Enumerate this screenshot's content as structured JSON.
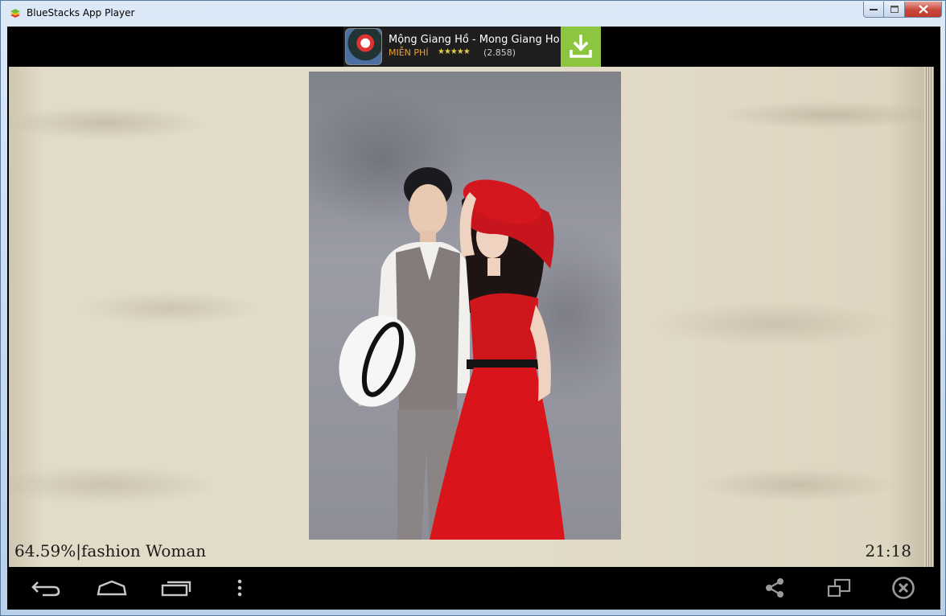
{
  "window": {
    "title": "BlueStacks App Player"
  },
  "ad": {
    "title": "Mộng Giang Hồ - Mong Giang Ho",
    "price_label": "MIỄN PHÍ",
    "stars": "★★★★★",
    "rating_count": "(2.858)",
    "accent_color": "#8cc63f"
  },
  "reader": {
    "progress_text": "64.59%",
    "book_title": "fashion Woman",
    "clock": "21:18"
  },
  "navbar": {
    "left_icons": [
      "back-icon",
      "home-icon",
      "recent-apps-icon",
      "menu-dots-icon"
    ],
    "right_icons": [
      "share-icon",
      "window-resize-icon",
      "close-circle-icon"
    ]
  }
}
